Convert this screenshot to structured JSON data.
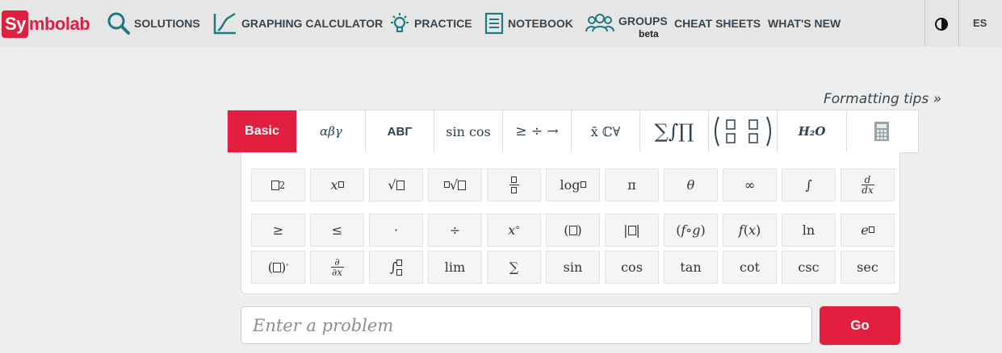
{
  "logo": {
    "part1": "Sy",
    "part2": "mbolab"
  },
  "nav": {
    "solutions": "SOLUTIONS",
    "graphing": "GRAPHING CALCULATOR",
    "practice": "PRACTICE",
    "notebook": "NOTEBOOK",
    "groups": "GROUPS",
    "groups_badge": "beta",
    "cheat_sheets": "CHEAT SHEETS",
    "whats_new": "WHAT'S NEW",
    "language": "ES"
  },
  "formatting_tips": "Formatting tips »",
  "tabs": [
    {
      "label": "Basic"
    },
    {
      "label": "αβγ"
    },
    {
      "label": "ΑΒΓ"
    },
    {
      "label": "sin cos"
    },
    {
      "label": "≥ ÷ →"
    },
    {
      "label": "x̄ ℂ∀"
    },
    {
      "label": "∑∫∏"
    },
    {
      "label": "matrix"
    },
    {
      "label": "H₂O"
    },
    {
      "label": "calculator"
    }
  ],
  "keys": {
    "row1": [
      "□²",
      "x^□",
      "√□",
      "ⁿ√□",
      "□/□",
      "log□",
      "π",
      "θ",
      "∞",
      "∫",
      "d/dx"
    ],
    "row2": [
      "≥",
      "≤",
      "·",
      "÷",
      "x°",
      "(□)",
      "|□|",
      "(f∘g)",
      "f(x)",
      "ln",
      "e^□"
    ],
    "row3": [
      "(□)'",
      "∂/∂x",
      "∫□□",
      "lim",
      "∑",
      "sin",
      "cos",
      "tan",
      "cot",
      "csc",
      "sec"
    ]
  },
  "input": {
    "placeholder": "Enter a problem",
    "value": ""
  },
  "go_label": "Go",
  "colors": {
    "accent": "#e21f3f",
    "text": "#38454f",
    "icon_teal": "#1d7b7f"
  }
}
